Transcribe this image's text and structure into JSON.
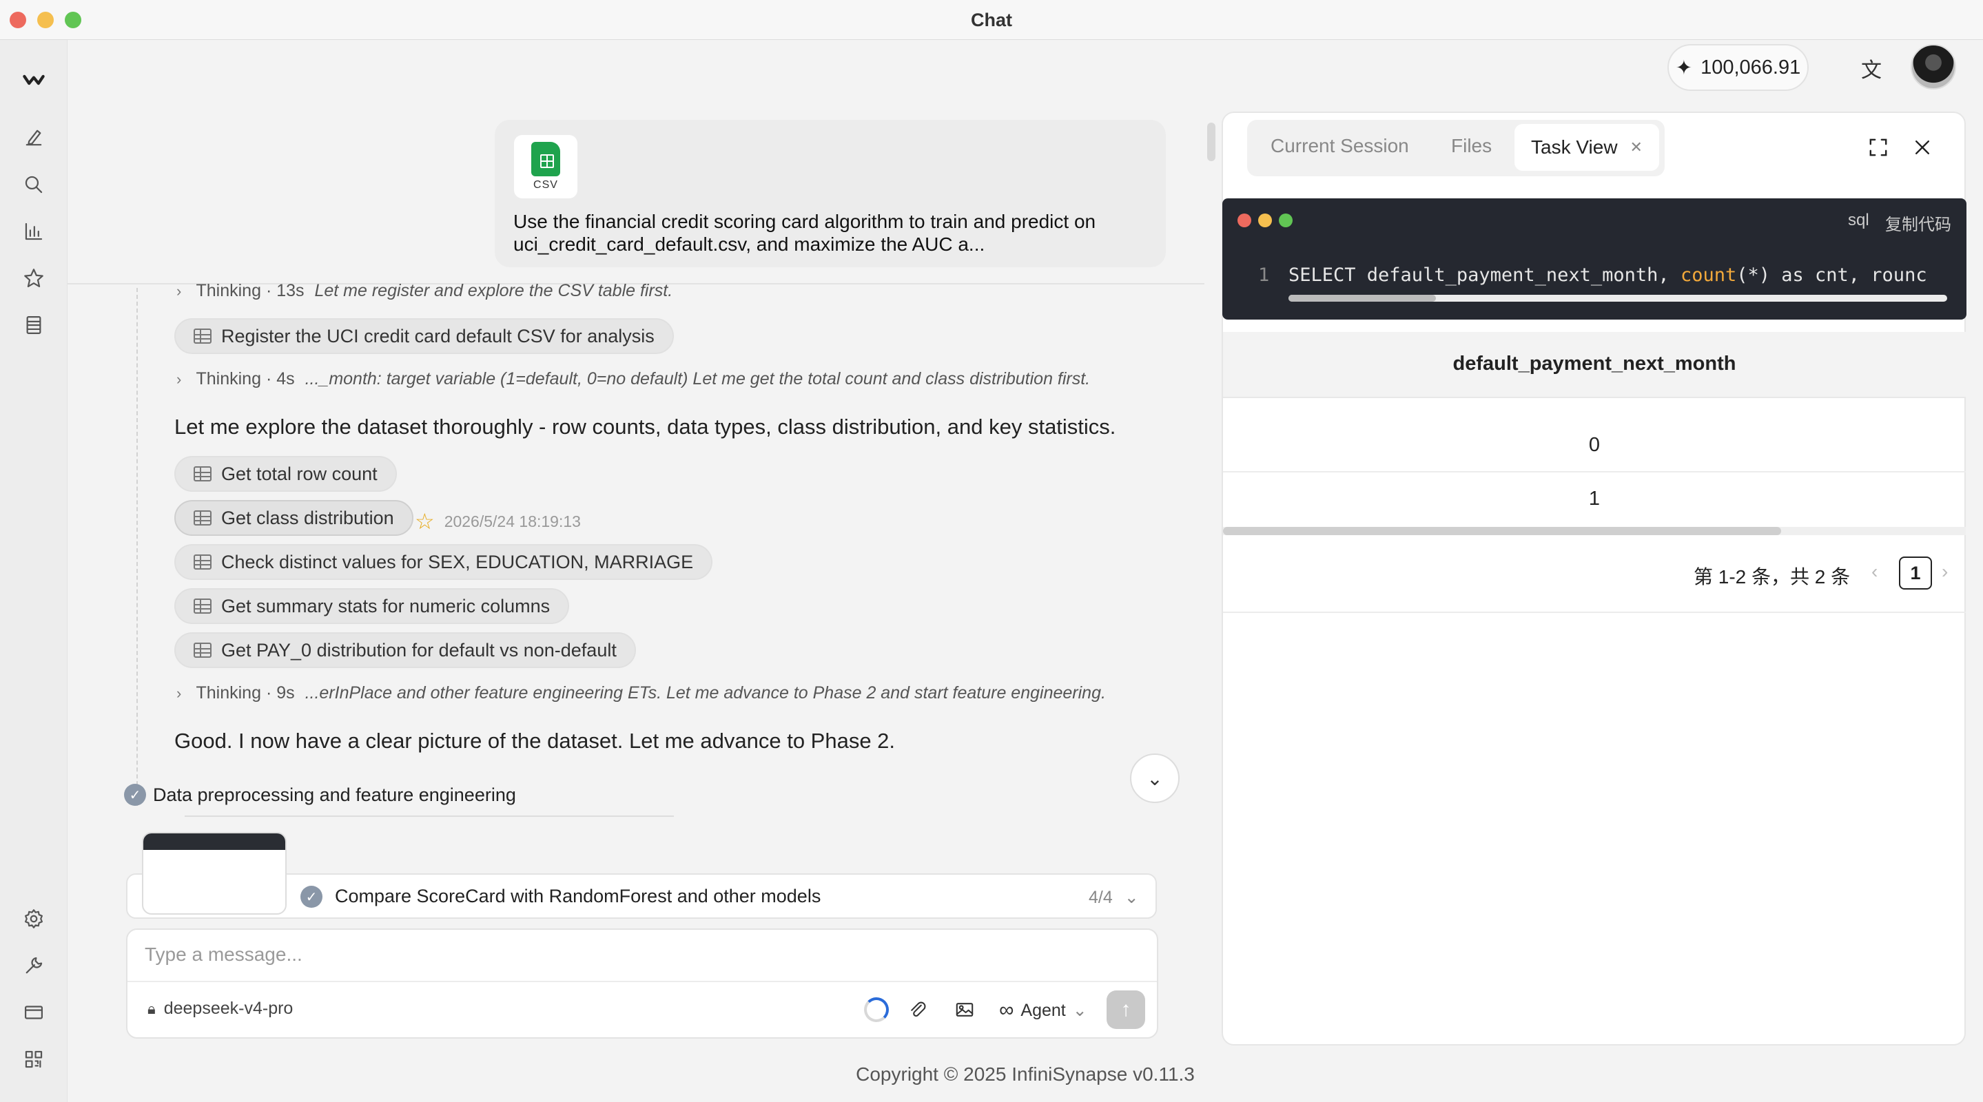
{
  "window": {
    "title": "Chat"
  },
  "colors": {
    "close": "#ed6a5e",
    "minimize": "#f5bf4f",
    "maximize": "#61c554",
    "accent": "#2a6bd9"
  },
  "sidebar": {
    "icons": [
      "logo-icon",
      "edit-icon",
      "search-icon",
      "chart-icon",
      "star-icon",
      "document-icon",
      "settings-icon",
      "wrench-icon",
      "card-icon",
      "qr-icon"
    ]
  },
  "header": {
    "credits": "100,066.91"
  },
  "user_message": {
    "attachment_label": "CSV",
    "text": "Use the financial credit scoring card algorithm to train and predict on uci_credit_card_default.csv, and maximize the AUC a..."
  },
  "thread": {
    "thinking1": {
      "label": "Thinking · 13s",
      "detail": "Let me register and explore the CSV table first."
    },
    "tool1": "Register the UCI credit card default CSV for analysis",
    "thinking2": {
      "label": "Thinking · 4s",
      "detail": "..._month: target variable (1=default, 0=no default) Let me get the total count and class distribution first."
    },
    "para1": "Let me explore the dataset thoroughly - row counts, data types, class distribution, and key statistics.",
    "tools": [
      "Get total row count",
      "Get class distribution",
      "Check distinct values for SEX, EDUCATION, MARRIAGE",
      "Get summary stats for numeric columns",
      "Get PAY_0 distribution for default vs non-default"
    ],
    "timestamp": "2026/5/24 18:19:13",
    "thinking3": {
      "label": "Thinking · 9s",
      "detail": "...erInPlace and other feature engineering ETs. Let me advance to Phase 2 and start feature engineering."
    },
    "para2": "Good. I now have a clear picture of the dataset. Let me advance to Phase 2.",
    "phase": "Data preprocessing and feature engineering"
  },
  "task": {
    "text": "Compare ScoreCard with RandomForest and other models",
    "count": "4/4"
  },
  "composer": {
    "placeholder": "Type a message...",
    "model": "deepseek-v4-pro",
    "mode": "Agent"
  },
  "footer": {
    "copyright": "Copyright © 2025 InfiniSynapse v0.11.3"
  },
  "panel": {
    "tabs": {
      "current_session": "Current Session",
      "files": "Files",
      "task_view": "Task View"
    },
    "code": {
      "lang": "sql",
      "copy_label": "复制代码",
      "line_number": "1",
      "before": "SELECT default_payment_next_month, ",
      "keyword": "count",
      "after": "(*) as cnt, rounc"
    },
    "table": {
      "column": "default_payment_next_month",
      "rows": [
        "0",
        "1"
      ]
    },
    "pagination": {
      "summary": "第 1-2 条，共 2 条",
      "page": "1"
    }
  }
}
